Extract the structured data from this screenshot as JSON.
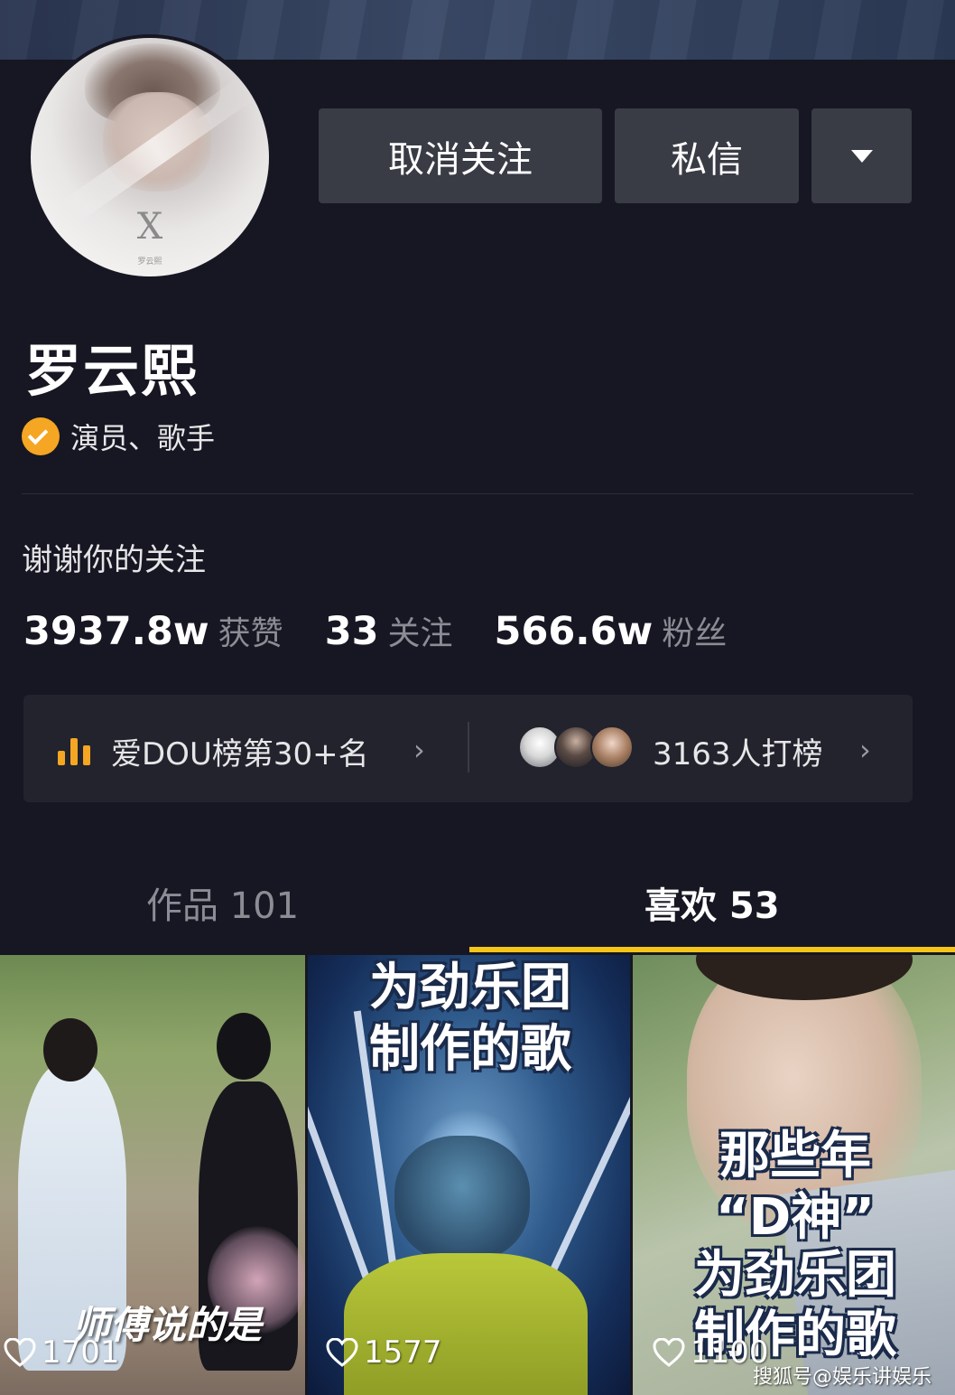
{
  "profile": {
    "name": "罗云熙",
    "verification": "演员、歌手",
    "bio": "谢谢你的关注",
    "avatar_text": "X",
    "avatar_caption": "罗云熙"
  },
  "actions": {
    "unfollow_label": "取消关注",
    "message_label": "私信",
    "more_icon": "caret-down-icon"
  },
  "stats": [
    {
      "value": "3937.8w",
      "label": "获赞"
    },
    {
      "value": "33",
      "label": "关注"
    },
    {
      "value": "566.6w",
      "label": "粉丝"
    }
  ],
  "ranking": {
    "rank_text": "爱DOU榜第30+名",
    "supporters_text": "3163人打榜",
    "accent_color": "#f5a623"
  },
  "tabs": [
    {
      "label": "作品 101",
      "active": false
    },
    {
      "label": "喜欢 53",
      "active": true
    }
  ],
  "videos": [
    {
      "overlay_lines": [
        "师傅说的是"
      ],
      "likes": "1701"
    },
    {
      "overlay_lines": [
        "为劲乐团",
        "制作的歌"
      ],
      "likes": "1577"
    },
    {
      "overlay_lines": [
        "那些年",
        "“D神”",
        "为劲乐团",
        "制作的歌"
      ],
      "likes": "1100"
    }
  ],
  "watermark": "搜狐号@娱乐讲娱乐",
  "colors": {
    "background": "#161722",
    "tab_underline": "#f5c518",
    "button": "#393b45"
  }
}
